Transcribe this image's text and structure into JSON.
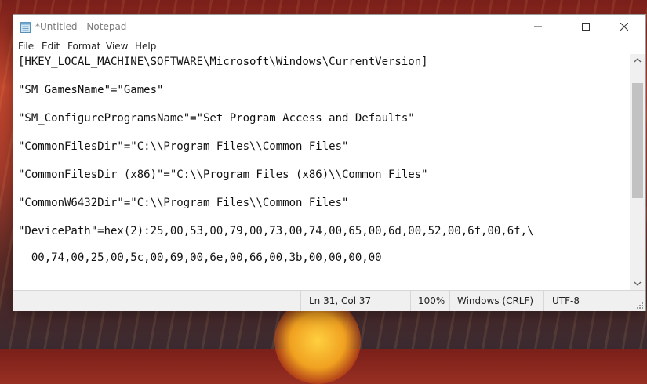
{
  "window": {
    "title": "*Untitled - Notepad",
    "controls": {
      "minimize": "minimize-icon",
      "maximize": "maximize-icon",
      "close": "close-icon"
    }
  },
  "menu": {
    "file": "File",
    "edit": "Edit",
    "format": "Format",
    "view": "View",
    "help": "Help"
  },
  "editor": {
    "lines": [
      "[HKEY_LOCAL_MACHINE\\SOFTWARE\\Microsoft\\Windows\\CurrentVersion]",
      "\"SM_GamesName\"=\"Games\"",
      "\"SM_ConfigureProgramsName\"=\"Set Program Access and Defaults\"",
      "\"CommonFilesDir\"=\"C:\\\\Program Files\\\\Common Files\"",
      "\"CommonFilesDir (x86)\"=\"C:\\\\Program Files (x86)\\\\Common Files\"",
      "\"CommonW6432Dir\"=\"C:\\\\Program Files\\\\Common Files\"",
      "\"DevicePath\"=hex(2):25,00,53,00,79,00,73,00,74,00,65,00,6d,00,52,00,6f,00,6f,\\",
      "  00,74,00,25,00,5c,00,69,00,6e,00,66,00,3b,00,00,00,00"
    ]
  },
  "status": {
    "position": "Ln 31, Col 37",
    "zoom": "100%",
    "line_ending": "Windows (CRLF)",
    "encoding": "UTF-8"
  },
  "colors": {
    "accent_bg": "#c4472e",
    "window_bg": "#ffffff",
    "statusbar_bg": "#f0f0f0"
  }
}
